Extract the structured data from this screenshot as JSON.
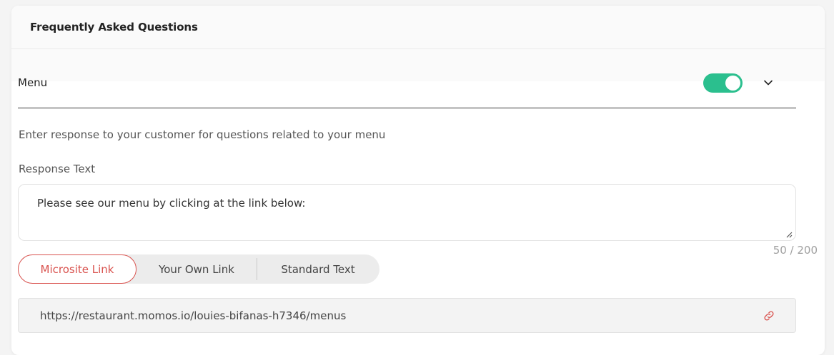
{
  "header": {
    "title": "Frequently Asked Questions"
  },
  "section": {
    "title": "Menu",
    "toggle_on": true,
    "toggle_color": "#2bbf8e",
    "expand_icon": "chevron-down-icon"
  },
  "description": "Enter response to your customer for questions related to your menu",
  "response": {
    "label": "Response Text",
    "value": "Please see our menu by clicking at the link below:",
    "char_count": "50 / 200"
  },
  "link_type": {
    "options": [
      "Microsite Link",
      "Your Own Link",
      "Standard Text"
    ],
    "selected": "Microsite Link",
    "accent_color": "#d9534f"
  },
  "url": {
    "value": "https://restaurant.momos.io/louies-bifanas-h7346/menus",
    "icon": "link-icon"
  }
}
